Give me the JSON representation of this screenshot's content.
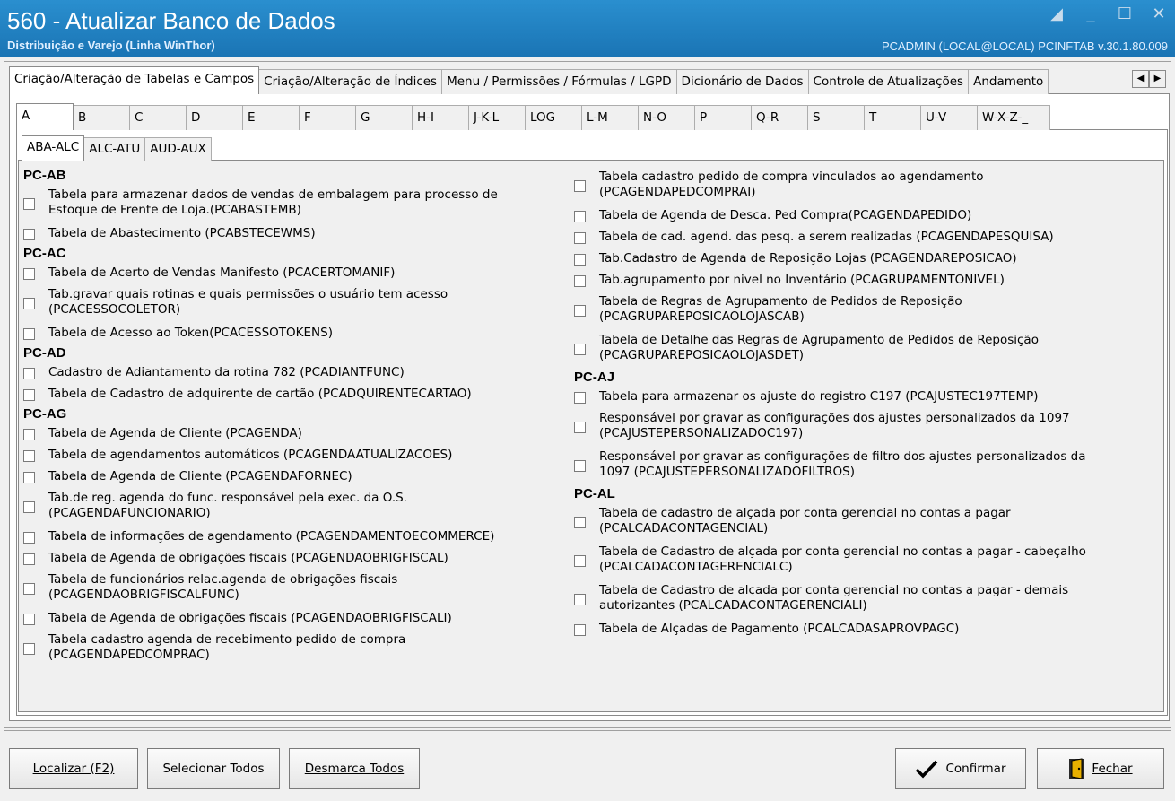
{
  "window": {
    "title": "560 - Atualizar Banco de Dados",
    "subtitle": "Distribuição e Varejo (Linha WinThor)",
    "user_info": "PCADMIN (LOCAL@LOCAL)  PCINFTAB  v.30.1.80.009",
    "controls": [
      "restore-icon",
      "minimize-icon",
      "maximize-icon",
      "close-icon"
    ]
  },
  "main_tabs": [
    {
      "label": "Criação/Alteração de Tabelas e Campos",
      "active": true
    },
    {
      "label": "Criação/Alteração de Índices"
    },
    {
      "label": "Menu / Permissões / Fórmulas / LGPD"
    },
    {
      "label": "Dicionário de Dados"
    },
    {
      "label": "Controle de Atualizações"
    },
    {
      "label": "Andamento"
    }
  ],
  "letter_tabs": [
    "A",
    "B",
    "C",
    "D",
    "E",
    "F",
    "G",
    "H-I",
    "J-K-L",
    "LOG",
    "L-M",
    "N-O",
    "P",
    "Q-R",
    "S",
    "T",
    "U-V",
    "W-X-Z-_"
  ],
  "sub_tabs": [
    "ABA-ALC",
    "ALC-ATU",
    "AUD-AUX"
  ],
  "left_groups": [
    {
      "title": "PC-AB",
      "items": [
        {
          "text": "Tabela para armazenar dados de vendas de embalagem para processo de\nEstoque de Frente de Loja.(PCABASTEMB)",
          "two": true
        },
        {
          "text": "Tabela de Abastecimento (PCABSTECEWMS)"
        }
      ]
    },
    {
      "title": "PC-AC",
      "items": [
        {
          "text": "Tabela de Acerto de Vendas Manifesto (PCACERTOMANIF)"
        },
        {
          "text": "Tab.gravar quais rotinas e quais permissões o usuário tem acesso\n(PCACESSOCOLETOR)",
          "two": true
        },
        {
          "text": "Tabela de Acesso ao Token(PCACESSOTOKENS)"
        }
      ]
    },
    {
      "title": "PC-AD",
      "items": [
        {
          "text": "Cadastro de Adiantamento da rotina 782 (PCADIANTFUNC)"
        },
        {
          "text": "Tabela de Cadastro de adquirente de cartão (PCADQUIRENTECARTAO)"
        }
      ]
    },
    {
      "title": "PC-AG",
      "items": [
        {
          "text": "Tabela  de Agenda de Cliente (PCAGENDA)"
        },
        {
          "text": "Tabela de agendamentos automáticos (PCAGENDAATUALIZACOES)"
        },
        {
          "text": "Tabela  de Agenda de Cliente (PCAGENDAFORNEC)"
        },
        {
          "text": "Tab.de reg. agenda do func. responsável pela exec. da O.S.\n(PCAGENDAFUNCIONARIO)",
          "two": true
        },
        {
          "text": "Tabela de informações de agendamento (PCAGENDAMENTOECOMMERCE)"
        },
        {
          "text": "Tabela de Agenda de obrigações fiscais (PCAGENDAOBRIGFISCAL)"
        },
        {
          "text": "Tabela de funcionários relac.agenda de obrigações fiscais\n(PCAGENDAOBRIGFISCALFUNC)",
          "two": true
        },
        {
          "text": "Tabela de Agenda de obrigações fiscais (PCAGENDAOBRIGFISCALI)"
        },
        {
          "text": "Tabela cadastro agenda de recebimento pedido de compra\n(PCAGENDAPEDCOMPRAC)",
          "two": true
        }
      ]
    }
  ],
  "right_groups": [
    {
      "title": "",
      "items": [
        {
          "text": "Tabela cadastro pedido de compra vinculados ao agendamento\n(PCAGENDAPEDCOMPRAI)",
          "two": true
        },
        {
          "text": "Tabela  de Agenda de Desca. Ped Compra(PCAGENDAPEDIDO)"
        },
        {
          "text": "Tabela de cad. agend. das pesq. a serem realizadas (PCAGENDAPESQUISA)"
        },
        {
          "text": "Tab.Cadastro de Agenda de Reposição Lojas (PCAGENDAREPOSICAO)"
        },
        {
          "text": "Tab.agrupamento por nivel no Inventário (PCAGRUPAMENTONIVEL)"
        },
        {
          "text": "Tabela de Regras de Agrupamento de Pedidos de Reposição\n(PCAGRUPAREPOSICAOLOJASCAB)",
          "two": true
        },
        {
          "text": "Tabela de Detalhe das Regras de Agrupamento de Pedidos de Reposição\n(PCAGRUPAREPOSICAOLOJASDET)",
          "two": true
        }
      ]
    },
    {
      "title": "PC-AJ",
      "items": [
        {
          "text": "Tabela para armazenar os ajuste do registro C197 (PCAJUSTEC197TEMP)"
        },
        {
          "text": "Responsável por gravar as configurações dos ajustes personalizados da 1097\n(PCAJUSTEPERSONALIZADOC197)",
          "two": true
        },
        {
          "text": "Responsável por gravar as configurações de filtro dos ajustes personalizados da\n1097 (PCAJUSTEPERSONALIZADOFILTROS)",
          "two": true
        }
      ]
    },
    {
      "title": "PC-AL",
      "items": [
        {
          "text": "Tabela de cadastro de alçada por conta gerencial no contas a pagar\n(PCALCADACONTAGENCIAL)",
          "two": true
        },
        {
          "text": "Tabela de Cadastro de alçada por conta gerencial no contas a pagar - cabeçalho\n(PCALCADACONTAGERENCIALC)",
          "two": true
        },
        {
          "text": "Tabela de Cadastro de alçada por conta gerencial no contas a pagar - demais\nautorizantes (PCALCADACONTAGERENCIALI)",
          "two": true
        },
        {
          "text": "Tabela de Alçadas de Pagamento (PCALCADASAPROVPAGC)"
        }
      ]
    }
  ],
  "buttons": {
    "localizar": "Localizar (F2)",
    "selecionar_todos": "Selecionar Todos",
    "desmarca_todos": "Desmarca Todos",
    "confirmar": "Confirmar",
    "fechar": "Fechar"
  }
}
